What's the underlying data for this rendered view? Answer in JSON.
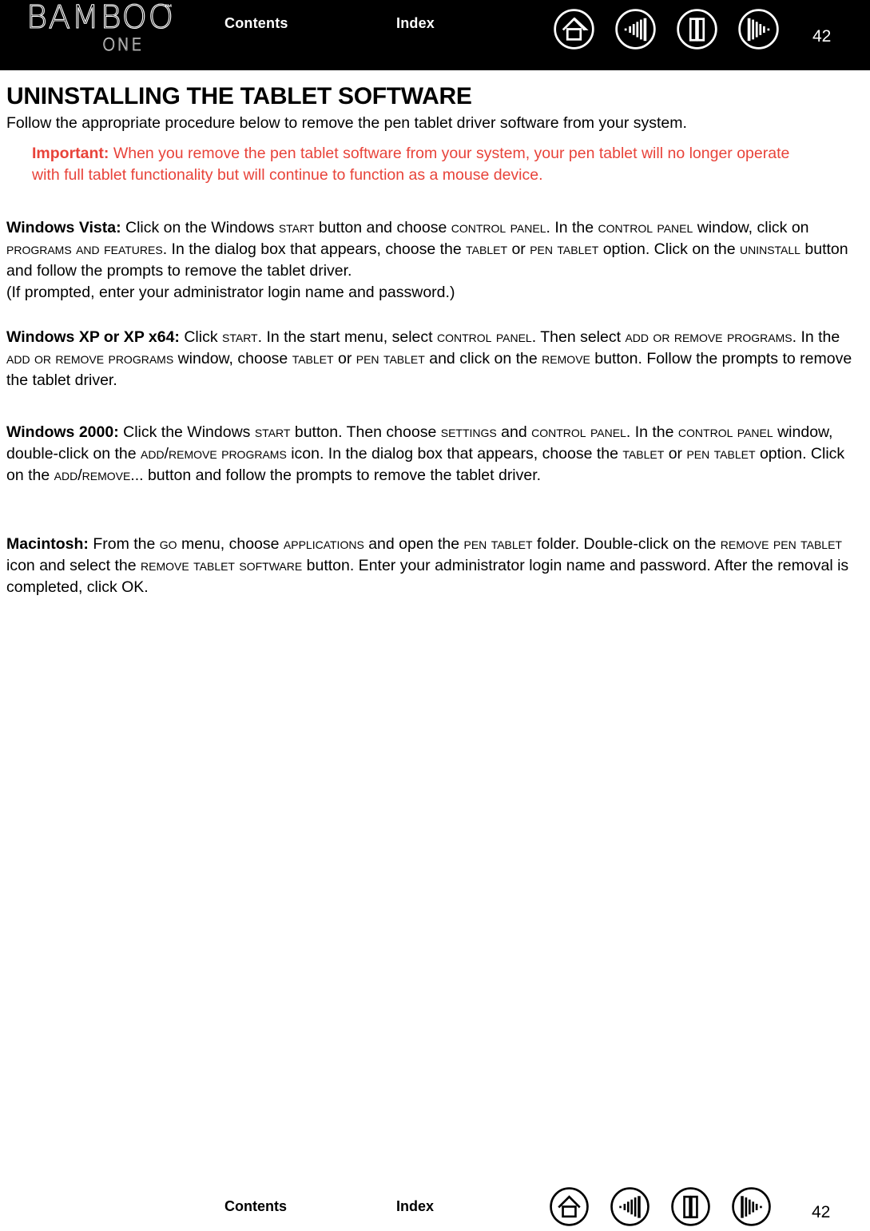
{
  "header": {
    "logo": {
      "wordmark": "BAMBOO",
      "trademark": "™",
      "subtitle": "ONE"
    },
    "contents_label": "Contents",
    "index_label": "Index",
    "page_number": "42",
    "nav_icons": [
      {
        "name": "home-icon",
        "title": "Home"
      },
      {
        "name": "go-back-icon",
        "title": "Previous view"
      },
      {
        "name": "two-page-view-icon",
        "title": "Page view"
      },
      {
        "name": "go-forward-icon",
        "title": "Next view"
      }
    ]
  },
  "main": {
    "title": "UNINSTALLING THE TABLET SOFTWARE",
    "intro": "Follow the appropriate procedure below to remove the pen tablet driver software from your system.",
    "important": {
      "label": "Important:",
      "text": " When you remove the pen tablet software from your system, your pen tablet will no longer operate with full tablet functionality but will continue to function as a mouse device."
    },
    "procedures": [
      {
        "id": "windows-vista",
        "heading": "Windows Vista:",
        "body_html": " Click on the Windows <span class=\"sc\">START</span> button and choose <span class=\"sc\">CONTROL PANEL</span>.  In the <span class=\"sc\">CONTROL PANEL</span> window, click on <span class=\"sc\">PROGRAMS AND FEATURES</span>.  In the dialog box that appears, choose the <span class=\"sc\">TABLET</span> or <span class=\"sc\">PEN TABLET</span> option.  Click on the <span class=\"sc\">UNINSTALL</span> button and follow the prompts to remove the tablet driver.<br>(If prompted, enter your administrator login name and password.)",
        "plain_text": "Windows Vista: Click on the Windows START button and choose CONTROL PANEL.  In the CONTROL PANEL window, click on PROGRAMS AND FEATURES.  In the dialog box that appears, choose the TABLET or PEN TABLET option.  Click on the UNINSTALL button and follow the prompts to remove the tablet driver. (If prompted, enter your administrator login name and password.)"
      },
      {
        "id": "windows-xp",
        "heading": "Windows XP or XP x64:",
        "body_html": " Click <span class=\"sc\">START</span>.  In the start menu, select <span class=\"sc\">CONTROL PANEL</span>.  Then select <span class=\"sc\">ADD OR REMOVE PROGRAMS</span>.  In the <span class=\"sc\">ADD OR REMOVE PROGRAMS</span> window, choose <span class=\"sc\">TABLET</span> or <span class=\"sc\">PEN TABLET</span> and click on the <span class=\"sc\">REMOVE</span> button.  Follow the prompts to remove the tablet driver.",
        "plain_text": "Windows XP or XP x64: Click START.  In the start menu, select CONTROL PANEL.  Then select ADD OR REMOVE PROGRAMS.  In the ADD OR REMOVE PROGRAMS window, choose TABLET or PEN TABLET and click on the REMOVE button.  Follow the prompts to remove the tablet driver."
      },
      {
        "id": "windows-2000",
        "heading": "Windows 2000:",
        "body_html": " Click the Windows <span class=\"sc\">START</span> button.  Then choose <span class=\"sc\">SETTINGS</span> and <span class=\"sc\">CONTROL PANEL</span>.  In the <span class=\"sc\">CONTROL PANEL</span> window, double-click on the <span class=\"sc\">ADD/REMOVE PROGRAMS</span> icon.  In the dialog box that appears, choose the <span class=\"sc\">TABLET</span> or <span class=\"sc\">PEN TABLET</span> option.  Click on the <span class=\"sc\">ADD/REMOVE...</span> button and follow the prompts to remove the tablet driver.",
        "plain_text": "Windows 2000: Click the Windows START button.  Then choose SETTINGS and CONTROL PANEL.  In the CONTROL PANEL window, double-click on the ADD/REMOVE PROGRAMS icon.  In the dialog box that appears, choose the TABLET or PEN TABLET option.  Click on the ADD/REMOVE... button and follow the prompts to remove the tablet driver."
      },
      {
        "id": "macintosh",
        "heading": "Macintosh:",
        "body_html": "  From the <span class=\"sc\">GO</span> menu, choose <span class=\"sc\">APPLICATIONS</span> and open the <span class=\"sc\">PEN TABLET</span> folder.  Double-click on the <span class=\"sc\">REMOVE PEN TABLET</span> icon and select the <span class=\"sc\">REMOVE TABLET SOFTWARE</span> button.  Enter your administrator login name and password.  After the removal is completed, click OK.",
        "plain_text": "Macintosh:  From the GO menu, choose APPLICATIONS and open the PEN TABLET folder.  Double-click on the REMOVE PEN TABLET icon and select the REMOVE TABLET SOFTWARE button.  Enter your administrator login name and password.  After the removal is completed, click OK."
      }
    ]
  },
  "footer": {
    "contents_label": "Contents",
    "index_label": "Index",
    "page_number": "42",
    "nav_icons": [
      {
        "name": "home-icon",
        "title": "Home"
      },
      {
        "name": "go-back-icon",
        "title": "Previous view"
      },
      {
        "name": "two-page-view-icon",
        "title": "Page view"
      },
      {
        "name": "go-forward-icon",
        "title": "Next view"
      }
    ]
  },
  "colors": {
    "header_background": "#000000",
    "page_background": "#ffffff",
    "body_text": "#000000",
    "important_note": "#e8433a",
    "header_text": "#ffffff"
  }
}
